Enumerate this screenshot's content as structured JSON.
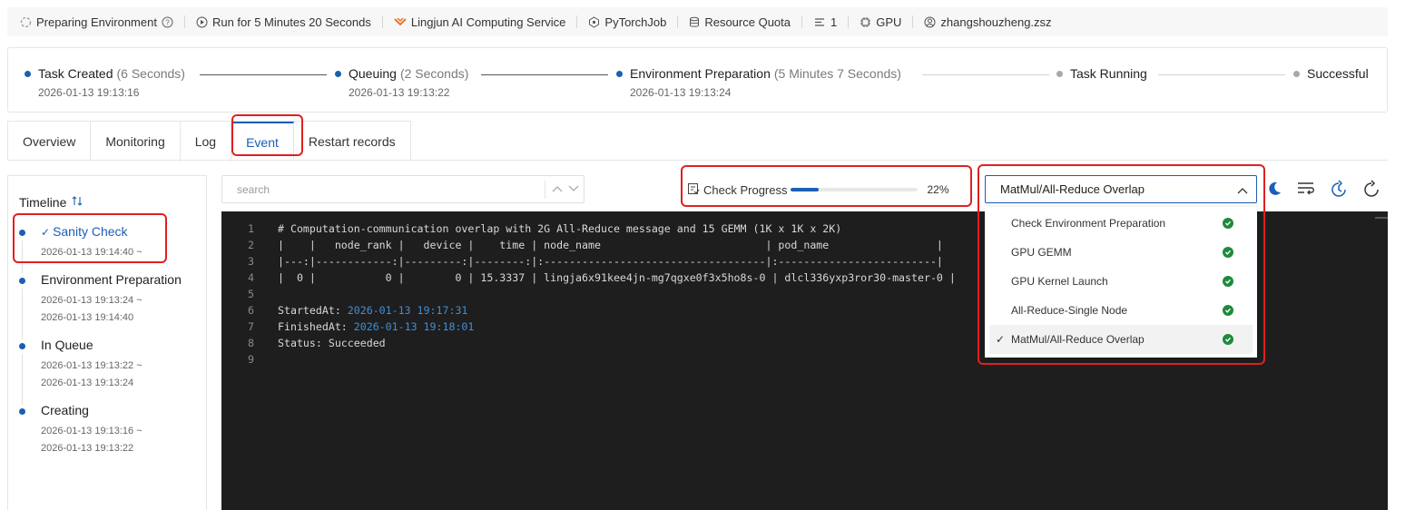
{
  "info_bar": {
    "status": "Preparing Environment",
    "run_time": "Run for 5 Minutes 20 Seconds",
    "service": "Lingjun AI Computing Service",
    "job_type": "PyTorchJob",
    "quota": "Resource Quota",
    "nodes": "1",
    "resource": "GPU",
    "user": "zhangshouzheng.zsz"
  },
  "steps": [
    {
      "name": "Task Created",
      "duration": "(6 Seconds)",
      "time": "2026-01-13 19:13:16",
      "state": "done"
    },
    {
      "name": "Queuing",
      "duration": "(2 Seconds)",
      "time": "2026-01-13 19:13:22",
      "state": "done"
    },
    {
      "name": "Environment Preparation",
      "duration": "(5 Minutes 7 Seconds)",
      "time": "2026-01-13 19:13:24",
      "state": "current"
    },
    {
      "name": "Task Running",
      "duration": "",
      "time": "",
      "state": "pending"
    },
    {
      "name": "Successful",
      "duration": "",
      "time": "",
      "state": "pending"
    }
  ],
  "tabs": [
    "Overview",
    "Monitoring",
    "Log",
    "Event",
    "Restart records"
  ],
  "active_tab": "Event",
  "timeline": {
    "title": "Timeline",
    "items": [
      {
        "label": "Sanity Check",
        "time1": "2026-01-13 19:14:40 ~",
        "time2": ""
      },
      {
        "label": "Environment Preparation",
        "time1": "2026-01-13 19:13:24 ~",
        "time2": "2026-01-13 19:14:40"
      },
      {
        "label": "In Queue",
        "time1": "2026-01-13 19:13:22 ~",
        "time2": "2026-01-13 19:13:24"
      },
      {
        "label": "Creating",
        "time1": "2026-01-13 19:13:16 ~",
        "time2": "2026-01-13 19:13:22"
      }
    ]
  },
  "search": {
    "placeholder": "search"
  },
  "check_progress": {
    "label": "Check Progress",
    "percent_text": "22%",
    "percent": 22
  },
  "select": {
    "value": "MatMul/All-Reduce Overlap",
    "options": [
      "Check Environment Preparation",
      "GPU GEMM",
      "GPU Kernel Launch",
      "All-Reduce-Single Node",
      "MatMul/All-Reduce Overlap"
    ]
  },
  "code": {
    "lines": [
      {
        "n": "1",
        "text": "# Computation-communication overlap with 2G All-Reduce message and 15 GEMM (1K x 1K x 2K)"
      },
      {
        "n": "2",
        "text": "|    |   node_rank |   device |    time | node_name                          | pod_name                 |"
      },
      {
        "n": "3",
        "text": "|---:|------------:|---------:|--------:|:-----------------------------------|:-------------------------|"
      },
      {
        "n": "4",
        "text": "|  0 |           0 |        0 | 15.3337 | lingja6x91kee4jn-mg7qgxe0f3x5ho8s-0 | dlcl336yxp3ror30-master-0 |"
      },
      {
        "n": "5",
        "text": ""
      },
      {
        "n": "6",
        "text": "StartedAt: ",
        "date": "2026-01-13 19:17:31"
      },
      {
        "n": "7",
        "text": "FinishedAt: ",
        "date": "2026-01-13 19:18:01"
      },
      {
        "n": "8",
        "text": "Status: Succeeded"
      },
      {
        "n": "9",
        "text": ""
      }
    ]
  },
  "colors": {
    "accent": "#1a5fb4",
    "success": "#1f8a3b",
    "highlight": "#e02020",
    "code_bg": "#1e1e1e"
  }
}
